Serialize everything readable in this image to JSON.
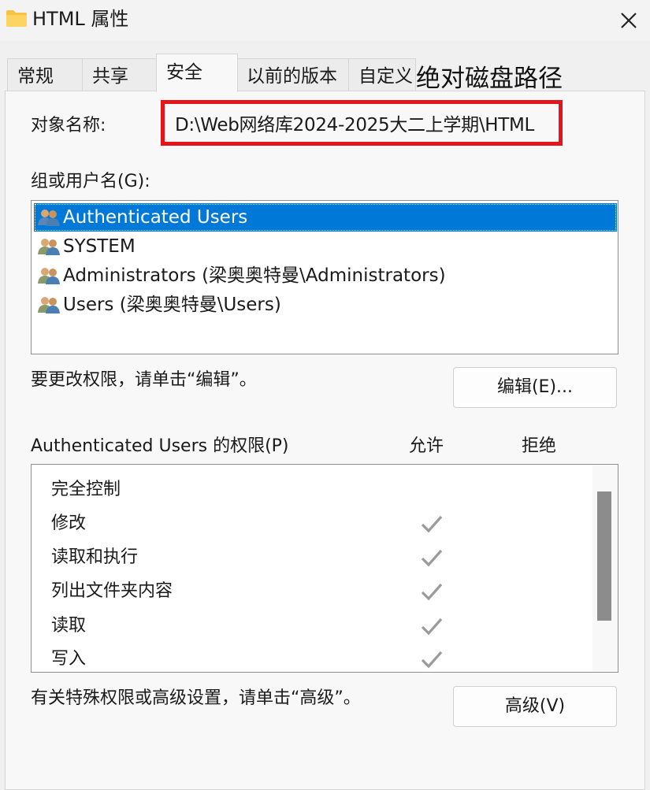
{
  "window": {
    "title": "HTML 属性",
    "close_label": "✕"
  },
  "tabs": [
    {
      "label": "常规",
      "active": false
    },
    {
      "label": "共享",
      "active": false
    },
    {
      "label": "安全",
      "active": true
    },
    {
      "label": "以前的版本",
      "active": false
    },
    {
      "label": "自定义",
      "active": false
    }
  ],
  "annotation": "绝对磁盘路径",
  "object": {
    "label": "对象名称:",
    "value": "D:\\Web网络库2024-2025大二上学期\\HTML"
  },
  "groups": {
    "label": "组或用户名(G):",
    "items": [
      {
        "name": "Authenticated Users",
        "selected": true
      },
      {
        "name": "SYSTEM",
        "selected": false
      },
      {
        "name": "Administrators (梁奥奥特曼\\Administrators)",
        "selected": false
      },
      {
        "name": "Users (梁奥奥特曼\\Users)",
        "selected": false
      }
    ]
  },
  "edit": {
    "hint": "要更改权限，请单击“编辑”。",
    "button_label": "编辑(E)..."
  },
  "permissions": {
    "header": "Authenticated Users 的权限(P)",
    "allow_label": "允许",
    "deny_label": "拒绝",
    "rows": [
      {
        "name": "完全控制",
        "allow": false,
        "deny": false
      },
      {
        "name": "修改",
        "allow": true,
        "deny": false
      },
      {
        "name": "读取和执行",
        "allow": true,
        "deny": false
      },
      {
        "name": "列出文件夹内容",
        "allow": true,
        "deny": false
      },
      {
        "name": "读取",
        "allow": true,
        "deny": false
      },
      {
        "name": "写入",
        "allow": true,
        "deny": false
      }
    ]
  },
  "advanced": {
    "hint": "有关特殊权限或高级设置，请单击“高级”。",
    "button_label": "高级(V)"
  },
  "colors": {
    "selection": "#0078d7",
    "highlight_border": "#e5141a",
    "check_gray": "#9b9b9b",
    "folder_yellow": "#f5c242"
  }
}
